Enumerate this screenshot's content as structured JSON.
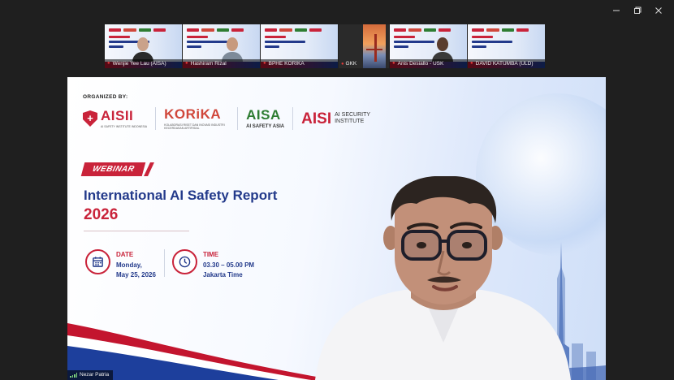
{
  "window": {
    "controls": [
      {
        "name": "minimize",
        "icon": "minimize-icon"
      },
      {
        "name": "maximize",
        "icon": "restore-icon"
      },
      {
        "name": "close",
        "icon": "close-icon"
      }
    ]
  },
  "participants": [
    {
      "name": "Wenjie Yee Lau (AISA)",
      "type": "slide-video"
    },
    {
      "name": "Hashiram Rizal",
      "type": "slide-video"
    },
    {
      "name": "BPHE KORIKA",
      "type": "slide"
    },
    {
      "name": "GKK",
      "type": "image"
    },
    {
      "name": "Anis Desiallo - USK",
      "type": "slide-video"
    },
    {
      "name": "DAVID KATUMBA (ULD)",
      "type": "slide"
    }
  ],
  "slide": {
    "organized_by": "ORGANIZED BY:",
    "logos": {
      "aisii": "AISII",
      "aisii_sub": "AI SAFETY INSTITUTE INDONESIA",
      "korika": "KORiKA",
      "korika_sub": "KOLABORASI RISET DAN INOVASI INDUSTRI KECERDASAN ARTIFISIAL",
      "aisa": "AISA",
      "aisa_sub": "AI SAFETY ASIA",
      "aisi": "AISI",
      "aisi_side": "AI SECURITY INSTITUTE"
    },
    "tag": "WEBINAR",
    "title_line1": "International AI Safety Report",
    "title_line2": "2026",
    "date_label": "DATE",
    "date_line1": "Monday,",
    "date_line2": "May 25, 2026",
    "time_label": "TIME",
    "time_line1": "03.30 – 05.00 PM",
    "time_line2": "Jakarta Time"
  },
  "presenter": {
    "name": "Nezar Patria"
  },
  "colors": {
    "brand_red": "#c9233a",
    "brand_blue": "#233a8b",
    "aisa_green": "#2e7d32"
  }
}
